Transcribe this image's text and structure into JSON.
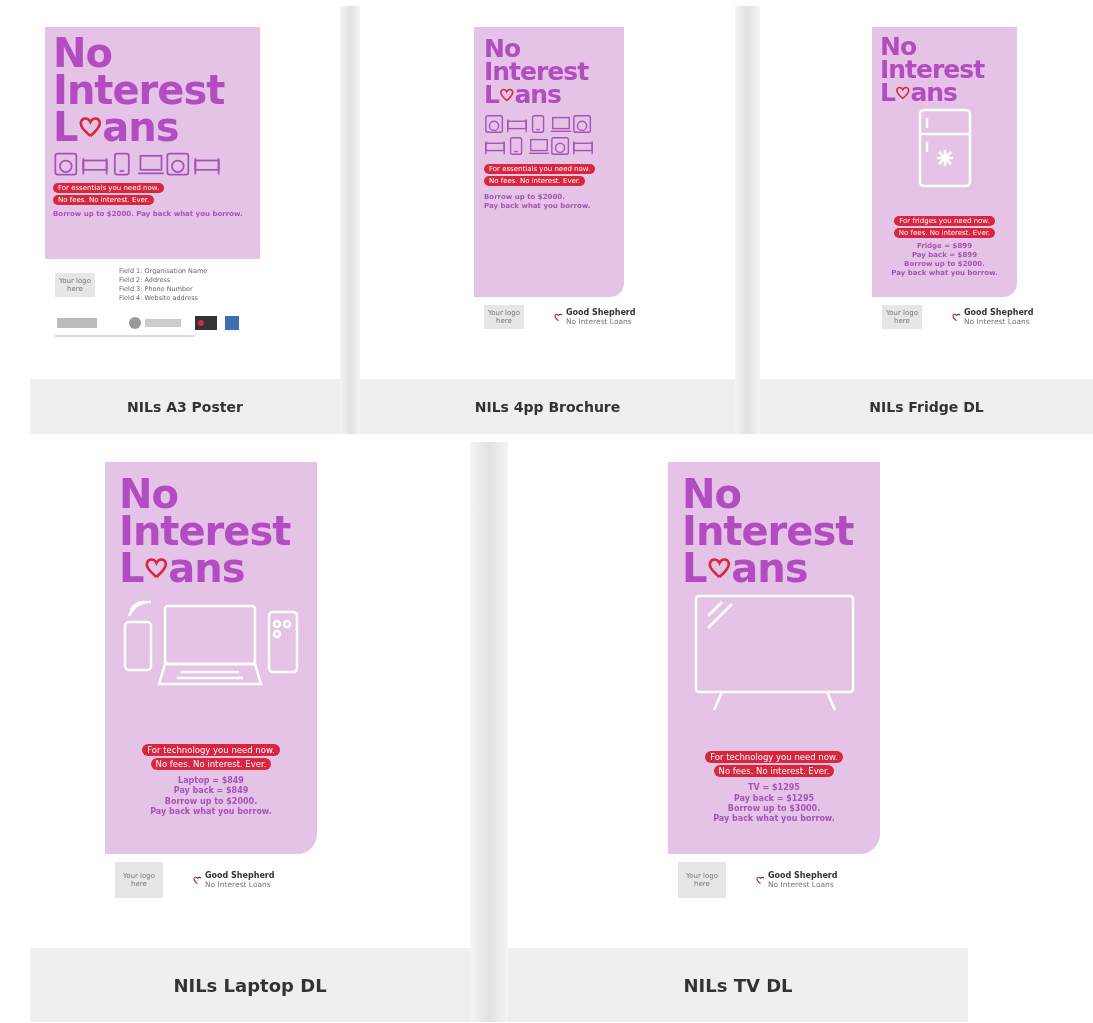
{
  "cards": [
    {
      "title": "NILs A3 Poster",
      "kind": "essentials",
      "heading": [
        "No",
        "Interest"
      ],
      "loans": [
        "L",
        "ans"
      ],
      "pills": [
        "For essentials you need now.",
        "No fees. No interest. Ever."
      ],
      "lines": [
        "Borrow up to $2000. Pay back what you borrow."
      ],
      "logo_placeholder": "Your logo here",
      "fields": [
        "Field 1: Organisation Name",
        "Field 2: Address",
        "Field 3: Phone Number",
        "Field 4: Website address"
      ]
    },
    {
      "title": "NILs 4pp Brochure",
      "kind": "essentials",
      "heading": [
        "No",
        "Interest"
      ],
      "loans": [
        "L",
        "ans"
      ],
      "pills": [
        "For essentials you need now.",
        "No fees. No interest. Ever."
      ],
      "lines": [
        "Borrow up to $2000.",
        "Pay back what you borrow."
      ],
      "logo_placeholder": "Your logo here",
      "partner": [
        "Good Shepherd",
        "No Interest Loans"
      ]
    },
    {
      "title": "NILs Fridge DL",
      "kind": "fridge",
      "heading": [
        "No",
        "Interest"
      ],
      "loans": [
        "L",
        "ans"
      ],
      "pills": [
        "For fridges you need now.",
        "No fees. No interest. Ever."
      ],
      "lines": [
        "Fridge = $899",
        "Pay back = $899",
        "Borrow up to $2000.",
        "Pay back what you borrow."
      ],
      "logo_placeholder": "Your logo here",
      "partner": [
        "Good Shepherd",
        "No Interest Loans"
      ]
    },
    {
      "title": "NILs Laptop DL",
      "kind": "tech",
      "heading": [
        "No",
        "Interest"
      ],
      "loans": [
        "L",
        "ans"
      ],
      "pills": [
        "For technology you need now.",
        "No fees. No interest. Ever."
      ],
      "lines": [
        "Laptop = $849",
        "Pay back = $849",
        "Borrow up to $2000.",
        "Pay back what you borrow."
      ],
      "logo_placeholder": "Your logo here",
      "partner": [
        "Good Shepherd",
        "No Interest Loans"
      ]
    },
    {
      "title": "NILs TV DL",
      "kind": "tv",
      "heading": [
        "No",
        "Interest"
      ],
      "loans": [
        "L",
        "ans"
      ],
      "pills": [
        "For technology you need now.",
        "No fees. No interest. Ever."
      ],
      "lines": [
        "TV = $1295",
        "Pay back = $1295",
        "Borrow up to $3000.",
        "Pay back what you borrow."
      ],
      "logo_placeholder": "Your logo here",
      "partner": [
        "Good Shepherd",
        "No Interest Loans"
      ]
    }
  ]
}
